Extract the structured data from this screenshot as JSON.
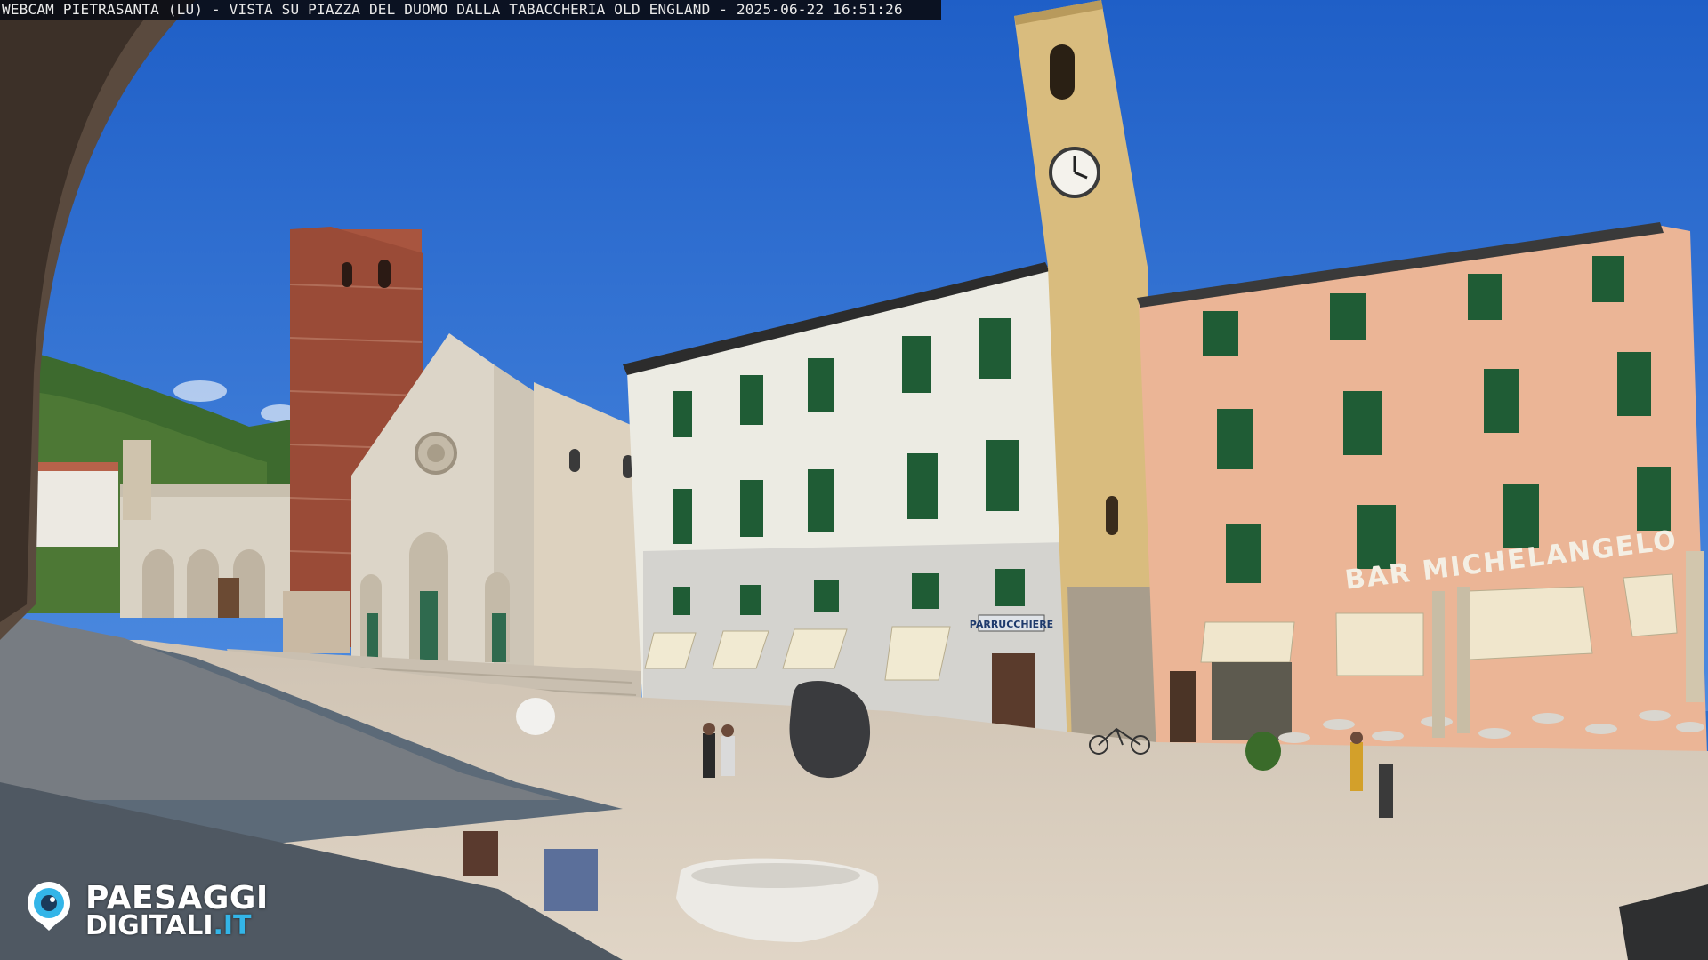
{
  "overlay": {
    "caption": "WEBCAM PIETRASANTA (LU) - VISTA SU PIAZZA DEL DUOMO DALLA TABACCHERIA OLD ENGLAND - 2025-06-22 16:51:26"
  },
  "logo": {
    "line1": "PAESAGGI",
    "line2_main": "DIGITALI",
    "line2_tld": ".IT",
    "icon": "eye-icon"
  },
  "signs": {
    "bar": "BAR MICHELANGELO",
    "shop": "PARRUCCHIERE"
  },
  "colors": {
    "sky": "#2c6fd0",
    "plaza": "#d8cdbd",
    "marble": "#dcd5c8",
    "brick_tower": "#a8553f",
    "white_building": "#ecebe3",
    "pink_building": "#ebb596",
    "clock_tower": "#d9bc7e",
    "shutters": "#1f5c35",
    "logo_accent": "#33b5e8"
  }
}
